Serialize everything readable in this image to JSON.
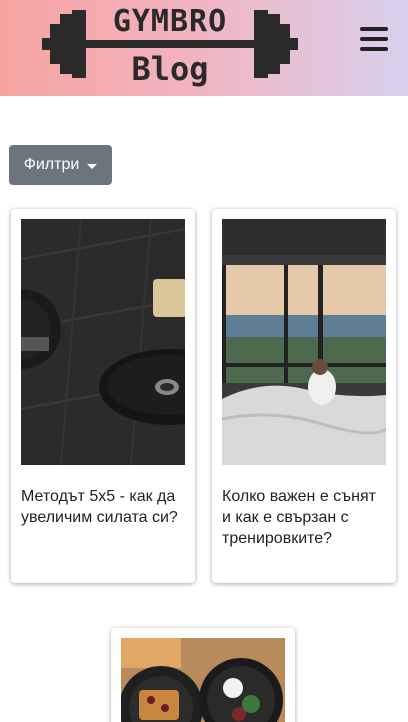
{
  "header": {
    "logo_top": "GYMBRO",
    "logo_bottom": "Blog",
    "menu_icon": "hamburger-menu-icon",
    "gradient_colors": [
      "#f6a4a0",
      "#f2b2bf",
      "#d8d0ee"
    ]
  },
  "filter": {
    "label": "Филтри",
    "icon": "caret-down-icon",
    "color": "#6c757d"
  },
  "posts": [
    {
      "title": "Методът 5x5 - как да увеличим силата си?",
      "image": "barbell-plates-on-gym-floor"
    },
    {
      "title": "Колко важен е сънят и как е свързан с тренировките?",
      "image": "woman-on-bed-by-window-sea-view"
    },
    {
      "title": "",
      "image": "healthy-breakfast-plates"
    }
  ]
}
